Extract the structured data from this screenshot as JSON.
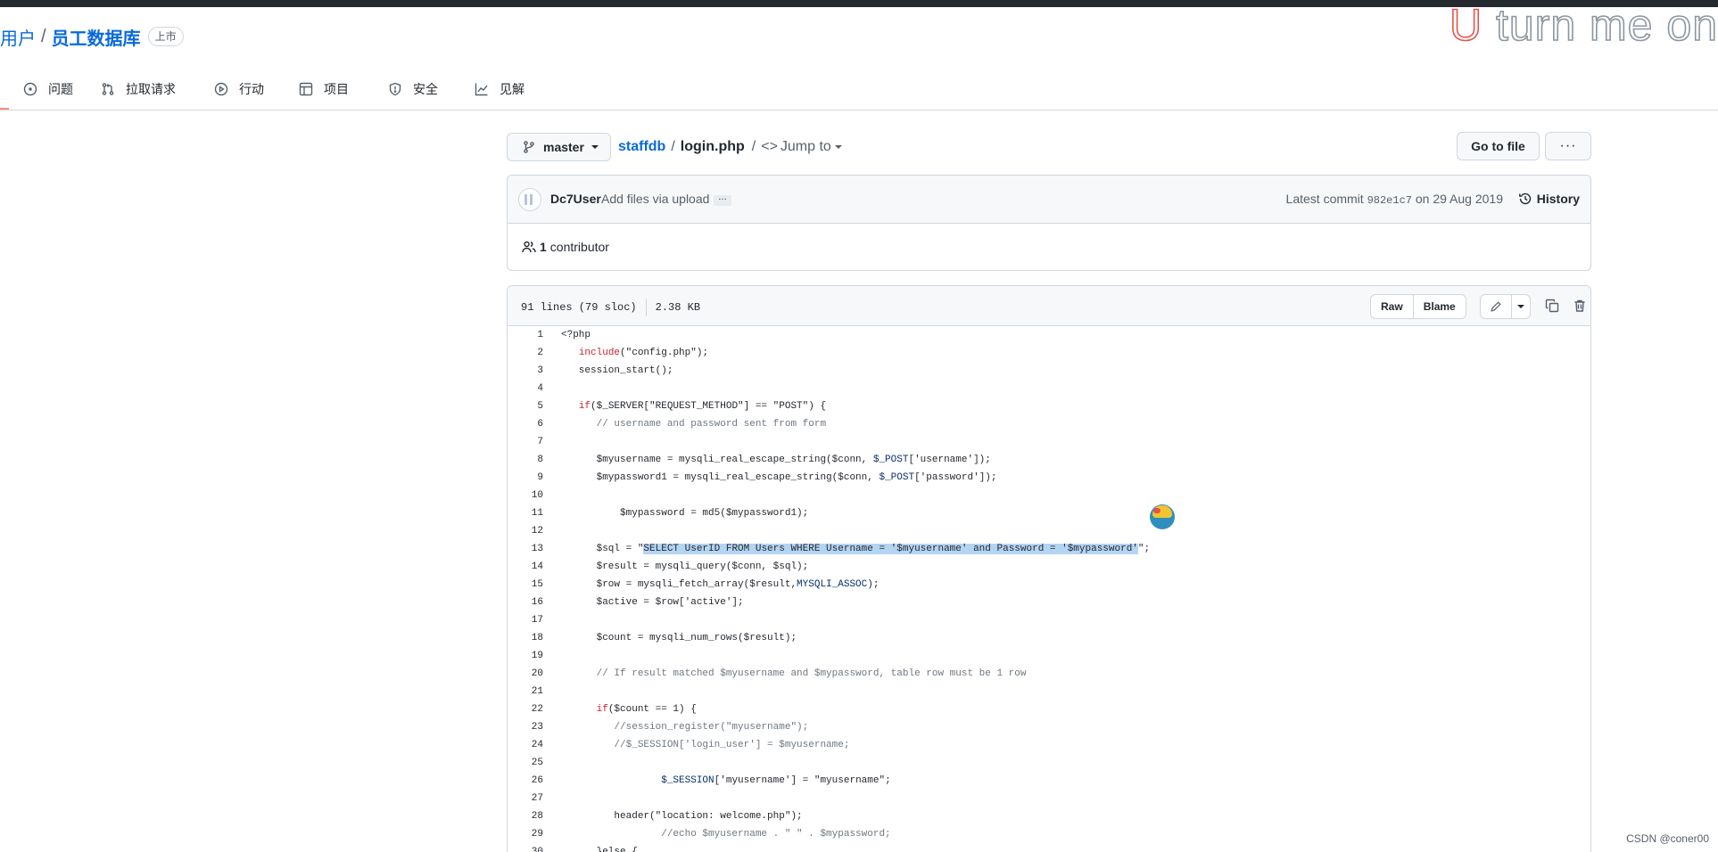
{
  "repo": {
    "owner": "用户",
    "separator": "/",
    "name": "员工数据库",
    "badge": "上市"
  },
  "watermark": {
    "first_letter": "U",
    "rest": " turn me on"
  },
  "tabs": [
    {
      "label": "问题",
      "icon": "issue-icon"
    },
    {
      "label": "拉取请求",
      "icon": "pull-request-icon"
    },
    {
      "label": "行动",
      "icon": "actions-play-icon"
    },
    {
      "label": "项目",
      "icon": "project-table-icon"
    },
    {
      "label": "安全",
      "icon": "shield-icon"
    },
    {
      "label": "见解",
      "icon": "graph-icon"
    }
  ],
  "branch": {
    "label": "master"
  },
  "breadcrumb": {
    "repo": "staffdb",
    "separator": "/",
    "file": "login.php",
    "jump_separator": "/",
    "jump_icon": "<>",
    "jump_label": "Jump to"
  },
  "actions": {
    "go_to_file": "Go to file",
    "more": "···"
  },
  "commit": {
    "author": "Dc7User",
    "message": "Add files via upload",
    "ellipsis": "…",
    "latest_prefix": "Latest commit",
    "sha": "982e1c7",
    "date": "on 29 Aug 2019",
    "history_label": "History"
  },
  "contributors": {
    "count": "1",
    "label": "contributor"
  },
  "file": {
    "lines_info": "91 lines (79 sloc)",
    "size": "2.38 KB",
    "raw_label": "Raw",
    "blame_label": "Blame"
  },
  "code_lines": [
    {
      "n": "1",
      "segs": [
        {
          "t": "<?php",
          "c": ""
        }
      ]
    },
    {
      "n": "2",
      "segs": [
        {
          "t": "   ",
          "c": ""
        },
        {
          "t": "include",
          "c": "k"
        },
        {
          "t": "(\"config.php\");",
          "c": ""
        }
      ]
    },
    {
      "n": "3",
      "segs": [
        {
          "t": "   session_start();",
          "c": ""
        }
      ]
    },
    {
      "n": "4",
      "segs": [
        {
          "t": "",
          "c": ""
        }
      ]
    },
    {
      "n": "5",
      "segs": [
        {
          "t": "   ",
          "c": ""
        },
        {
          "t": "if",
          "c": "k"
        },
        {
          "t": "($_SERVER[\"REQUEST_METHOD\"] == \"POST\") {",
          "c": ""
        }
      ]
    },
    {
      "n": "6",
      "segs": [
        {
          "t": "      // username and password sent from form",
          "c": "c"
        }
      ]
    },
    {
      "n": "7",
      "segs": [
        {
          "t": "",
          "c": ""
        }
      ]
    },
    {
      "n": "8",
      "segs": [
        {
          "t": "      $myusername = mysqli_real_escape_string($conn, ",
          "c": ""
        },
        {
          "t": "$_POST",
          "c": "s"
        },
        {
          "t": "['username']);",
          "c": ""
        }
      ]
    },
    {
      "n": "9",
      "segs": [
        {
          "t": "      $mypassword1 = mysqli_real_escape_string($conn, ",
          "c": ""
        },
        {
          "t": "$_POST",
          "c": "s"
        },
        {
          "t": "['password']);",
          "c": ""
        }
      ]
    },
    {
      "n": "10",
      "segs": [
        {
          "t": "",
          "c": ""
        }
      ]
    },
    {
      "n": "11",
      "segs": [
        {
          "t": "          $mypassword = md5($mypassword1);",
          "c": ""
        }
      ]
    },
    {
      "n": "12",
      "segs": [
        {
          "t": "",
          "c": ""
        }
      ]
    },
    {
      "n": "13",
      "segs": [
        {
          "t": "      $sql = \"",
          "c": ""
        },
        {
          "t": "SELECT UserID FROM Users WHERE Username = '$myusername' and Password = '$mypassword'",
          "c": "sel"
        },
        {
          "t": "\";",
          "c": ""
        }
      ]
    },
    {
      "n": "14",
      "segs": [
        {
          "t": "      $result = mysqli_query($conn, $sql);",
          "c": ""
        }
      ]
    },
    {
      "n": "15",
      "segs": [
        {
          "t": "      $row = mysqli_fetch_array($result,",
          "c": ""
        },
        {
          "t": "MYSQLI_ASSOC",
          "c": "s"
        },
        {
          "t": ");",
          "c": ""
        }
      ]
    },
    {
      "n": "16",
      "segs": [
        {
          "t": "      $active = $row['active'];",
          "c": ""
        }
      ]
    },
    {
      "n": "17",
      "segs": [
        {
          "t": "",
          "c": ""
        }
      ]
    },
    {
      "n": "18",
      "segs": [
        {
          "t": "      $count = mysqli_num_rows($result);",
          "c": ""
        }
      ]
    },
    {
      "n": "19",
      "segs": [
        {
          "t": "",
          "c": ""
        }
      ]
    },
    {
      "n": "20",
      "segs": [
        {
          "t": "      // If result matched $myusername and $mypassword, table row must be 1 row",
          "c": "c"
        }
      ]
    },
    {
      "n": "21",
      "segs": [
        {
          "t": "",
          "c": ""
        }
      ]
    },
    {
      "n": "22",
      "segs": [
        {
          "t": "      ",
          "c": ""
        },
        {
          "t": "if",
          "c": "k"
        },
        {
          "t": "($count == 1) {",
          "c": ""
        }
      ]
    },
    {
      "n": "23",
      "segs": [
        {
          "t": "         //session_register(\"myusername\");",
          "c": "c"
        }
      ]
    },
    {
      "n": "24",
      "segs": [
        {
          "t": "         //$_SESSION['login_user'] = $myusername;",
          "c": "c"
        }
      ]
    },
    {
      "n": "25",
      "segs": [
        {
          "t": "",
          "c": ""
        }
      ]
    },
    {
      "n": "26",
      "segs": [
        {
          "t": "                 ",
          "c": ""
        },
        {
          "t": "$_SESSION",
          "c": "s"
        },
        {
          "t": "['myusername'] = \"myusername\";",
          "c": ""
        }
      ]
    },
    {
      "n": "27",
      "segs": [
        {
          "t": "",
          "c": ""
        }
      ]
    },
    {
      "n": "28",
      "segs": [
        {
          "t": "         header(\"location: welcome.php\");",
          "c": ""
        }
      ]
    },
    {
      "n": "29",
      "segs": [
        {
          "t": "                 //echo $myusername . \" \" . $mypassword;",
          "c": "c"
        }
      ]
    },
    {
      "n": "30",
      "segs": [
        {
          "t": "      }else {",
          "c": ""
        }
      ]
    }
  ],
  "footer": {
    "credit": "CSDN @coner00"
  },
  "colors": {
    "link": "#0969da",
    "keyword": "#cf222e",
    "string": "#0a3069",
    "comment": "#6e7781",
    "selection": "#b4d4f3",
    "tab_underline": "#fd8c73"
  }
}
